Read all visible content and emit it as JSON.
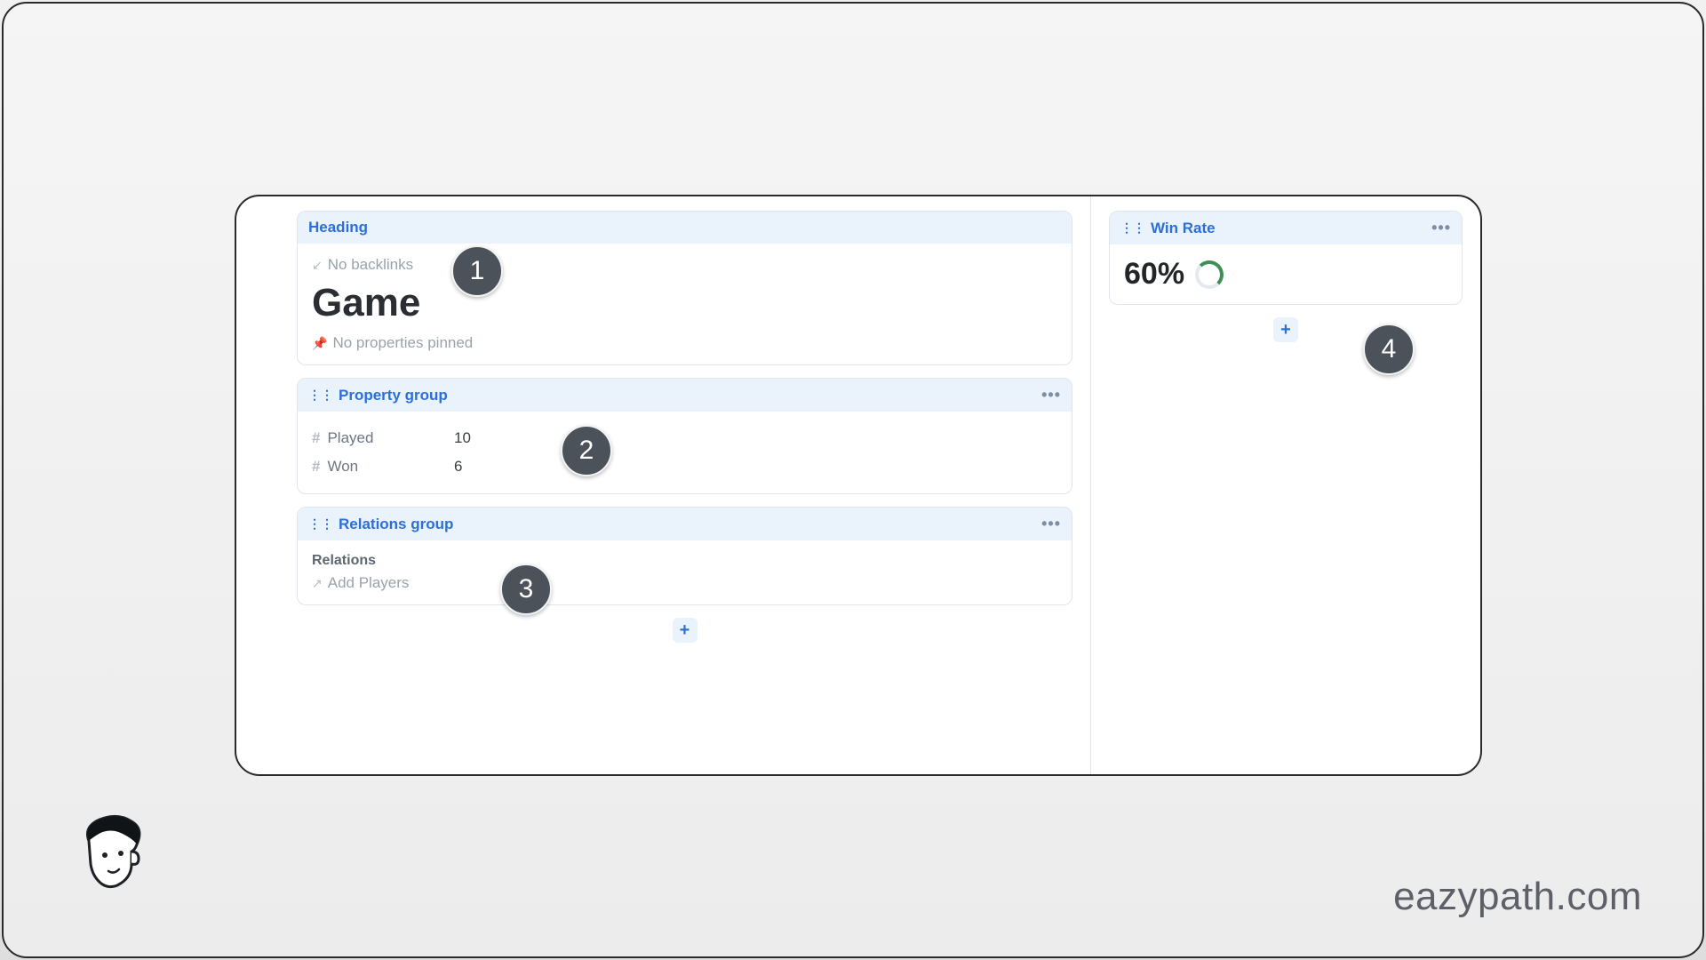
{
  "heading": {
    "panel_label": "Heading",
    "backlinks_text": "No backlinks",
    "title": "Game",
    "pinned_text": "No properties pinned"
  },
  "property_group": {
    "panel_label": "Property group",
    "rows": [
      {
        "label": "Played",
        "value": "10"
      },
      {
        "label": "Won",
        "value": "6"
      }
    ]
  },
  "relations_group": {
    "panel_label": "Relations group",
    "section_title": "Relations",
    "add_label": "Add Players"
  },
  "win_rate": {
    "panel_label": "Win Rate",
    "value": "60%"
  },
  "badges": {
    "b1": "1",
    "b2": "2",
    "b3": "3",
    "b4": "4"
  },
  "brand": "eazypath.com"
}
